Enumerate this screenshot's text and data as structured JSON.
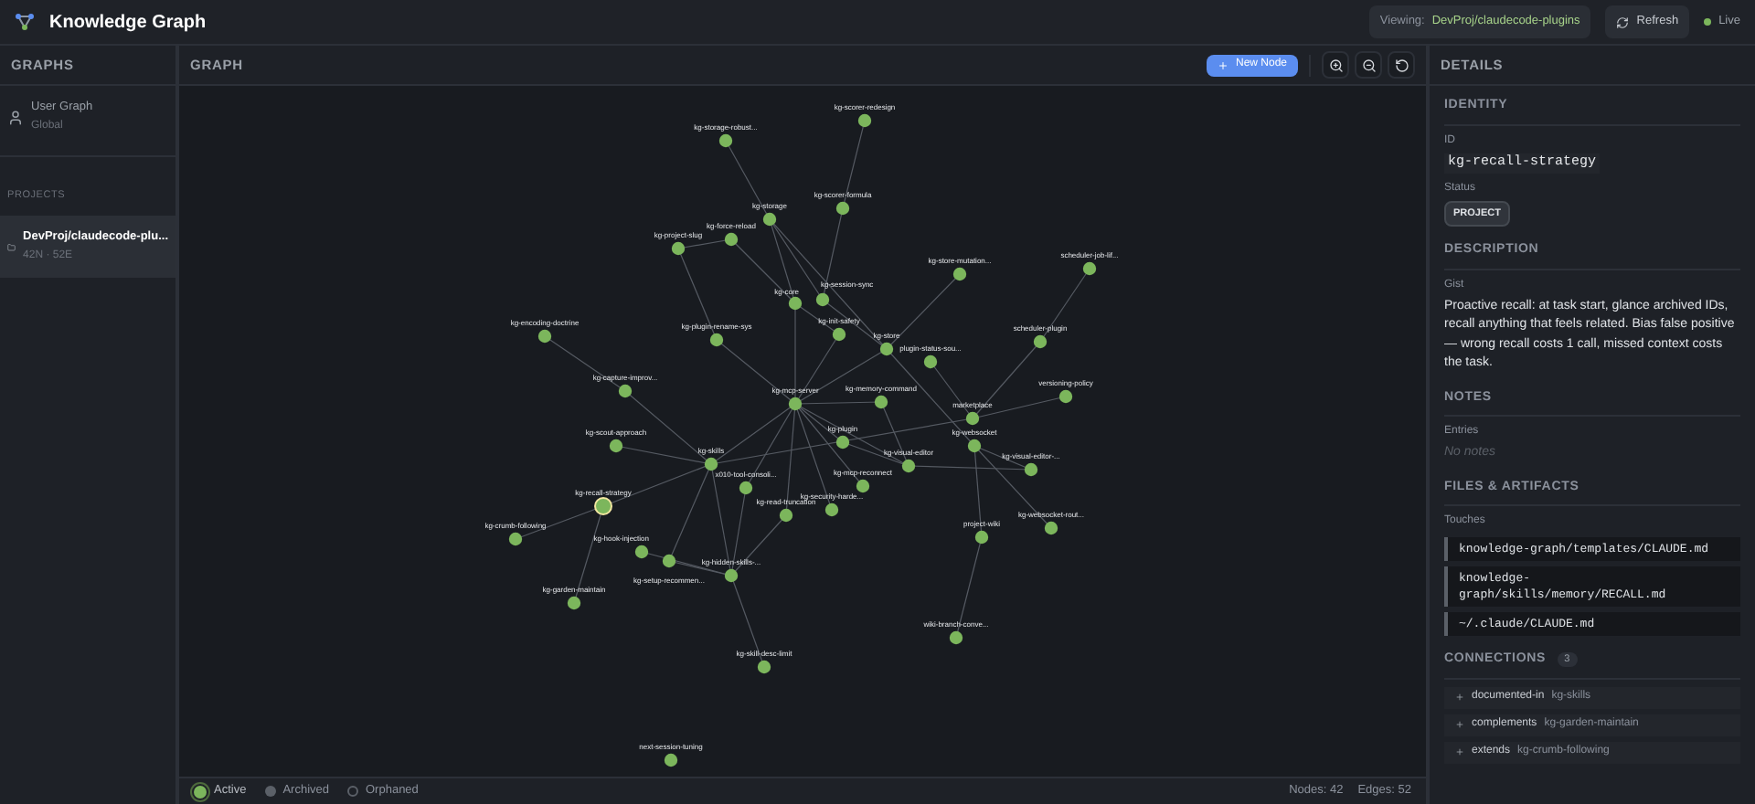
{
  "app": {
    "title": "Knowledge Graph",
    "viewing_label": "Viewing:",
    "viewing_value": "DevProj/claudecode-plugins",
    "refresh": "Refresh",
    "live": "Live"
  },
  "sidebar": {
    "title": "GRAPHS",
    "items": [
      {
        "name": "User Graph",
        "meta": "Global",
        "kind": "user",
        "selected": false
      }
    ],
    "section": "PROJECTS",
    "projects": [
      {
        "name": "DevProj/claudecode-plu...",
        "meta": "42N · 52E",
        "kind": "folder",
        "selected": true
      }
    ]
  },
  "graph": {
    "title": "GRAPH",
    "new_node": "New Node",
    "nodes": [
      {
        "label": "kg-scorer-redesign",
        "selected": false
      },
      {
        "label": "kg-storage-robust...",
        "selected": false
      },
      {
        "label": "kg-scorer-formula",
        "selected": false
      },
      {
        "label": "kg-storage",
        "selected": false
      },
      {
        "label": "kg-force-reload",
        "selected": false
      },
      {
        "label": "kg-project-slug",
        "selected": false
      },
      {
        "label": "kg-store-mutation...",
        "selected": false
      },
      {
        "label": "scheduler-job-lif...",
        "selected": false
      },
      {
        "label": "kg-core",
        "selected": false
      },
      {
        "label": "kg-session-sync",
        "selected": false
      },
      {
        "label": "kg-encoding-doctrine",
        "selected": false
      },
      {
        "label": "kg-plugin-rename-sys",
        "selected": false
      },
      {
        "label": "kg-init-safety",
        "selected": false
      },
      {
        "label": "kg-store",
        "selected": false
      },
      {
        "label": "plugin-status-sou...",
        "selected": false
      },
      {
        "label": "scheduler-plugin",
        "selected": false
      },
      {
        "label": "kg-capture-improv...",
        "selected": false
      },
      {
        "label": "kg-mcp-server",
        "selected": false
      },
      {
        "label": "kg-memory-command",
        "selected": false
      },
      {
        "label": "versioning-policy",
        "selected": false
      },
      {
        "label": "marketplace",
        "selected": false
      },
      {
        "label": "kg-scout-approach",
        "selected": false
      },
      {
        "label": "kg-plugin",
        "selected": false
      },
      {
        "label": "kg-websocket",
        "selected": false
      },
      {
        "label": "kg-skills",
        "selected": false
      },
      {
        "label": "kg-visual-editor",
        "selected": false
      },
      {
        "label": "kg-visual-editor-...",
        "selected": false
      },
      {
        "label": "x010-tool-consoli...",
        "selected": false
      },
      {
        "label": "kg-mcp-reconnect",
        "selected": false
      },
      {
        "label": "kg-recall-strategy",
        "selected": true
      },
      {
        "label": "kg-read-truncation",
        "selected": false
      },
      {
        "label": "kg-security-harde...",
        "selected": false
      },
      {
        "label": "kg-websocket-rout...",
        "selected": false
      },
      {
        "label": "kg-crumb-following",
        "selected": false
      },
      {
        "label": "project-wiki",
        "selected": false
      },
      {
        "label": "kg-hook-injection",
        "selected": false
      },
      {
        "label": "kg-setup-recommen...",
        "selected": false
      },
      {
        "label": "kg-hidden-skills-...",
        "selected": false
      },
      {
        "label": "kg-garden-maintain",
        "selected": false
      },
      {
        "label": "wiki-branch-conve...",
        "selected": false
      },
      {
        "label": "kg-skill-desc-limit",
        "selected": false
      },
      {
        "label": "next-session-tuning",
        "selected": false
      }
    ],
    "legend": [
      {
        "label": "Active",
        "kind": "active"
      },
      {
        "label": "Archived",
        "kind": "archived"
      },
      {
        "label": "Orphaned",
        "kind": "orphaned"
      }
    ],
    "nodes_count": "Nodes: 42",
    "edges_count": "Edges: 52"
  },
  "details": {
    "title": "DETAILS",
    "identity": {
      "heading": "IDENTITY",
      "id_label": "ID",
      "id": "kg-recall-strategy",
      "status_label": "Status",
      "status": "PROJECT"
    },
    "description": {
      "heading": "DESCRIPTION",
      "gist_label": "Gist",
      "gist": "Proactive recall: at task start, glance archived IDs, recall anything that feels related. Bias false positive — wrong recall costs 1 call, missed context costs the task."
    },
    "notes": {
      "heading": "NOTES",
      "entries_label": "Entries",
      "empty": "No notes"
    },
    "files": {
      "heading": "FILES & ARTIFACTS",
      "touches_label": "Touches",
      "items": [
        "knowledge-graph/templates/CLAUDE.md",
        "knowledge-graph/skills/memory/RECALL.md",
        "~/.claude/CLAUDE.md"
      ]
    },
    "connections": {
      "heading": "CONNECTIONS",
      "count": "3",
      "items": [
        {
          "relation": "documented-in",
          "target": "kg-skills"
        },
        {
          "relation": "complements",
          "target": "kg-garden-maintain"
        },
        {
          "relation": "extends",
          "target": "kg-crumb-following"
        }
      ]
    }
  }
}
